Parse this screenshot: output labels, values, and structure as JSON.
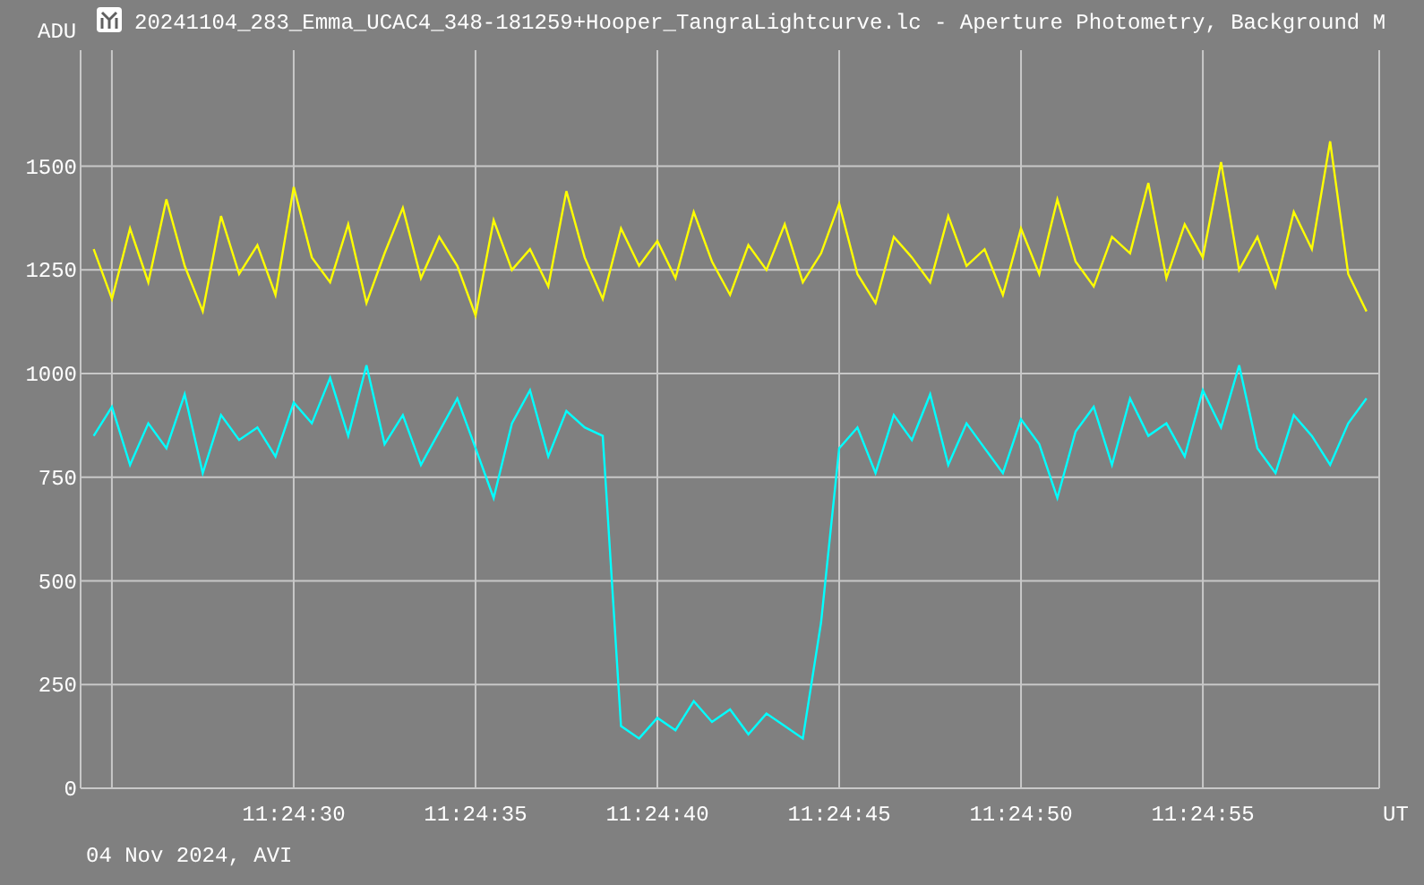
{
  "title": "20241104_283_Emma_UCAC4_348-181259+Hooper_TangraLightcurve.lc - Aperture Photometry, Background M",
  "footer": "04 Nov 2024, AVI",
  "chart_data": {
    "type": "line",
    "grid": true,
    "ylabel": "ADU",
    "xlabel": "UT",
    "ylim": [
      0,
      1780
    ],
    "yticks": [
      0,
      250,
      500,
      750,
      1000,
      1250,
      1500
    ],
    "categories": [
      null,
      null,
      null,
      null,
      null,
      null,
      null,
      null,
      null,
      null,
      null,
      "11:24:30",
      null,
      null,
      null,
      null,
      null,
      null,
      null,
      null,
      null,
      "11:24:35",
      null,
      null,
      null,
      null,
      null,
      null,
      null,
      null,
      null,
      "11:24:40",
      null,
      null,
      null,
      null,
      null,
      null,
      null,
      null,
      null,
      "11:24:45",
      null,
      null,
      null,
      null,
      null,
      null,
      null,
      null,
      null,
      "11:24:50",
      null,
      null,
      null,
      null,
      null,
      null,
      null,
      null,
      null,
      "11:24:55",
      null,
      null,
      null,
      null,
      null,
      null,
      null,
      null,
      null
    ],
    "series": [
      {
        "color": "#ffff00",
        "values": [
          1300,
          1180,
          1350,
          1220,
          1420,
          1260,
          1150,
          1380,
          1240,
          1310,
          1190,
          1450,
          1280,
          1220,
          1360,
          1170,
          1290,
          1400,
          1230,
          1330,
          1260,
          1140,
          1370,
          1250,
          1300,
          1210,
          1440,
          1280,
          1180,
          1350,
          1260,
          1320,
          1230,
          1390,
          1270,
          1190,
          1310,
          1250,
          1360,
          1220,
          1290,
          1410,
          1240,
          1170,
          1330,
          1280,
          1220,
          1380,
          1260,
          1300,
          1190,
          1350,
          1240,
          1420,
          1270,
          1210,
          1330,
          1290,
          1460,
          1230,
          1360,
          1280,
          1510,
          1250,
          1330,
          1210,
          1390,
          1300,
          1560,
          1240,
          1150
        ]
      },
      {
        "color": "#00ffff",
        "values": [
          850,
          920,
          780,
          880,
          820,
          950,
          760,
          900,
          840,
          870,
          800,
          930,
          880,
          990,
          850,
          1020,
          830,
          900,
          780,
          860,
          940,
          820,
          700,
          880,
          960,
          800,
          910,
          870,
          850,
          150,
          120,
          170,
          140,
          210,
          160,
          190,
          130,
          180,
          150,
          120,
          400,
          820,
          870,
          760,
          900,
          840,
          950,
          780,
          880,
          820,
          760,
          890,
          830,
          700,
          860,
          920,
          780,
          940,
          850,
          880,
          800,
          960,
          870,
          1020,
          820,
          760,
          900,
          850,
          780,
          880,
          940
        ]
      }
    ]
  }
}
